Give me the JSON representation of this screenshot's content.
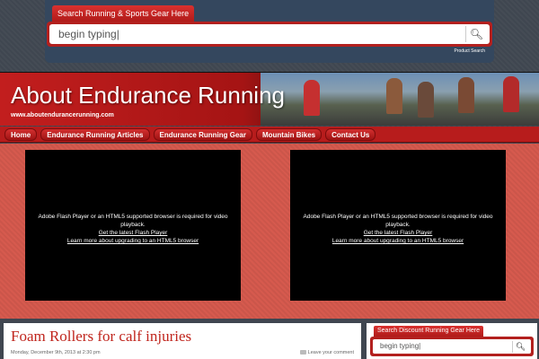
{
  "top_search": {
    "tab_label": "Search Running & Sports Gear Here",
    "input_value": "begin typing|",
    "button_icon": "search-icon",
    "caption": "Product Search"
  },
  "header": {
    "title": "About Endurance Running",
    "url": "www.aboutendurancerunning.com"
  },
  "nav": {
    "items": [
      {
        "label": "Home"
      },
      {
        "label": "Endurance Running Articles"
      },
      {
        "label": "Endurance Running Gear"
      },
      {
        "label": "Mountain Bikes"
      },
      {
        "label": "Contact Us"
      }
    ]
  },
  "videos": [
    {
      "message": "Adobe Flash Player or an HTML5 supported browser is required for video playback.",
      "link1": "Get the latest Flash Player",
      "link2": "Learn more about upgrading to an HTML5 browser"
    },
    {
      "message": "Adobe Flash Player or an HTML5 supported browser is required for video playback.",
      "link1": "Get the latest Flash Player",
      "link2": "Learn more about upgrading to an HTML5 browser"
    }
  ],
  "post": {
    "title": "Foam Rollers for calf injuries",
    "date": "Monday, December 9th, 2013 at 2:30 pm",
    "comment_label": "Leave your comment"
  },
  "sidebar_search": {
    "tab_label": "Search Discount Running Gear Here",
    "input_value": "begin typing|",
    "button_icon": "search-icon"
  },
  "colors": {
    "brand_red": "#b71c1c",
    "background": "#3f4650",
    "video_band": "#d65a4e"
  }
}
